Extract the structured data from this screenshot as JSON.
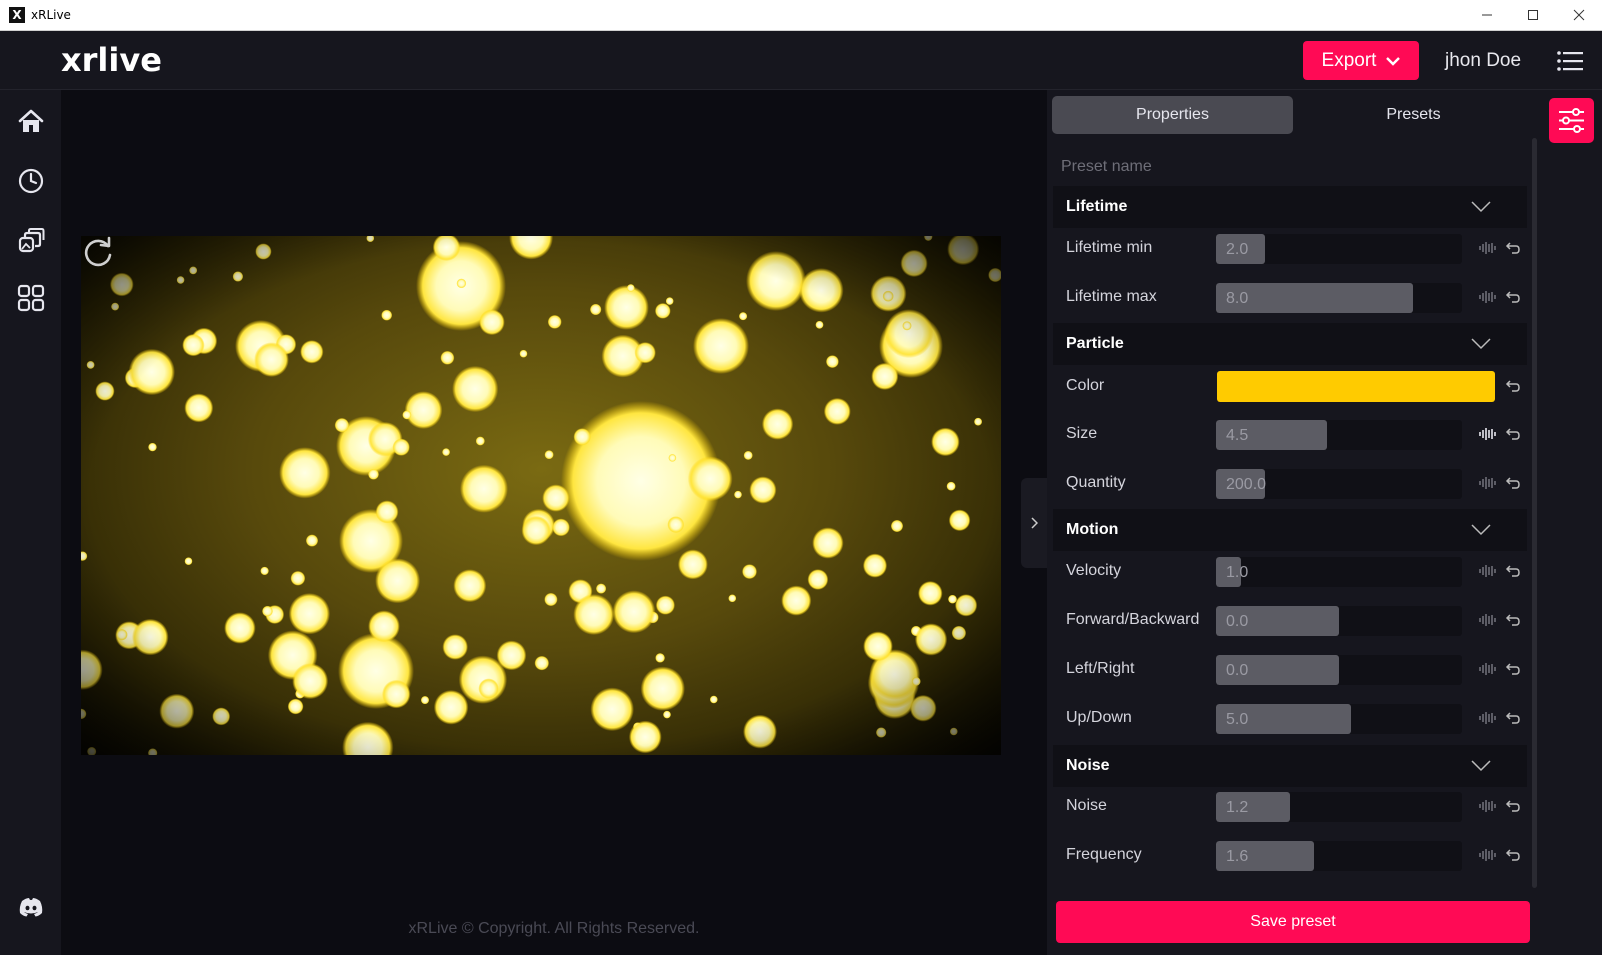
{
  "window": {
    "title": "xRLive",
    "app_icon": "X"
  },
  "header": {
    "logo": "xrlive",
    "export_label": "Export",
    "user_name": "jhon Doe"
  },
  "sidebar": {
    "items": [
      {
        "icon": "home-icon"
      },
      {
        "icon": "clock-icon"
      },
      {
        "icon": "layers-icon"
      },
      {
        "icon": "grid-icon"
      }
    ],
    "bottom_icon": "discord-icon"
  },
  "footer": {
    "copyright": "xRLive © Copyright. All Rights Reserved."
  },
  "panel": {
    "tabs": [
      {
        "label": "Properties",
        "active": true
      },
      {
        "label": "Presets",
        "active": false
      }
    ],
    "preset_name_placeholder": "Preset name",
    "groups": {
      "lifetime": "Lifetime",
      "particle": "Particle",
      "motion": "Motion",
      "noise": "Noise"
    },
    "props": {
      "lifetime_min": {
        "label": "Lifetime min",
        "value": "2.0",
        "fill": 0.2
      },
      "lifetime_max": {
        "label": "Lifetime max",
        "value": "8.0",
        "fill": 0.8
      },
      "color": {
        "label": "Color",
        "value": "#ffcb00"
      },
      "size": {
        "label": "Size",
        "value": "4.5",
        "fill": 0.45
      },
      "quantity": {
        "label": "Quantity",
        "value": "200.0",
        "fill": 0.2
      },
      "velocity": {
        "label": "Velocity",
        "value": "1.0",
        "fill": 0.1
      },
      "forward_backward": {
        "label": "Forward/Backward",
        "value": "0.0",
        "fill": 0.5
      },
      "left_right": {
        "label": "Left/Right",
        "value": "0.0",
        "fill": 0.5
      },
      "up_down": {
        "label": "Up/Down",
        "value": "5.0",
        "fill": 0.55
      },
      "noise": {
        "label": "Noise",
        "value": "1.2",
        "fill": 0.3
      },
      "frequency": {
        "label": "Frequency",
        "value": "1.6",
        "fill": 0.4
      }
    },
    "save_label": "Save preset"
  },
  "colors": {
    "accent": "#ff0a55",
    "particle": "#ffcb00"
  }
}
